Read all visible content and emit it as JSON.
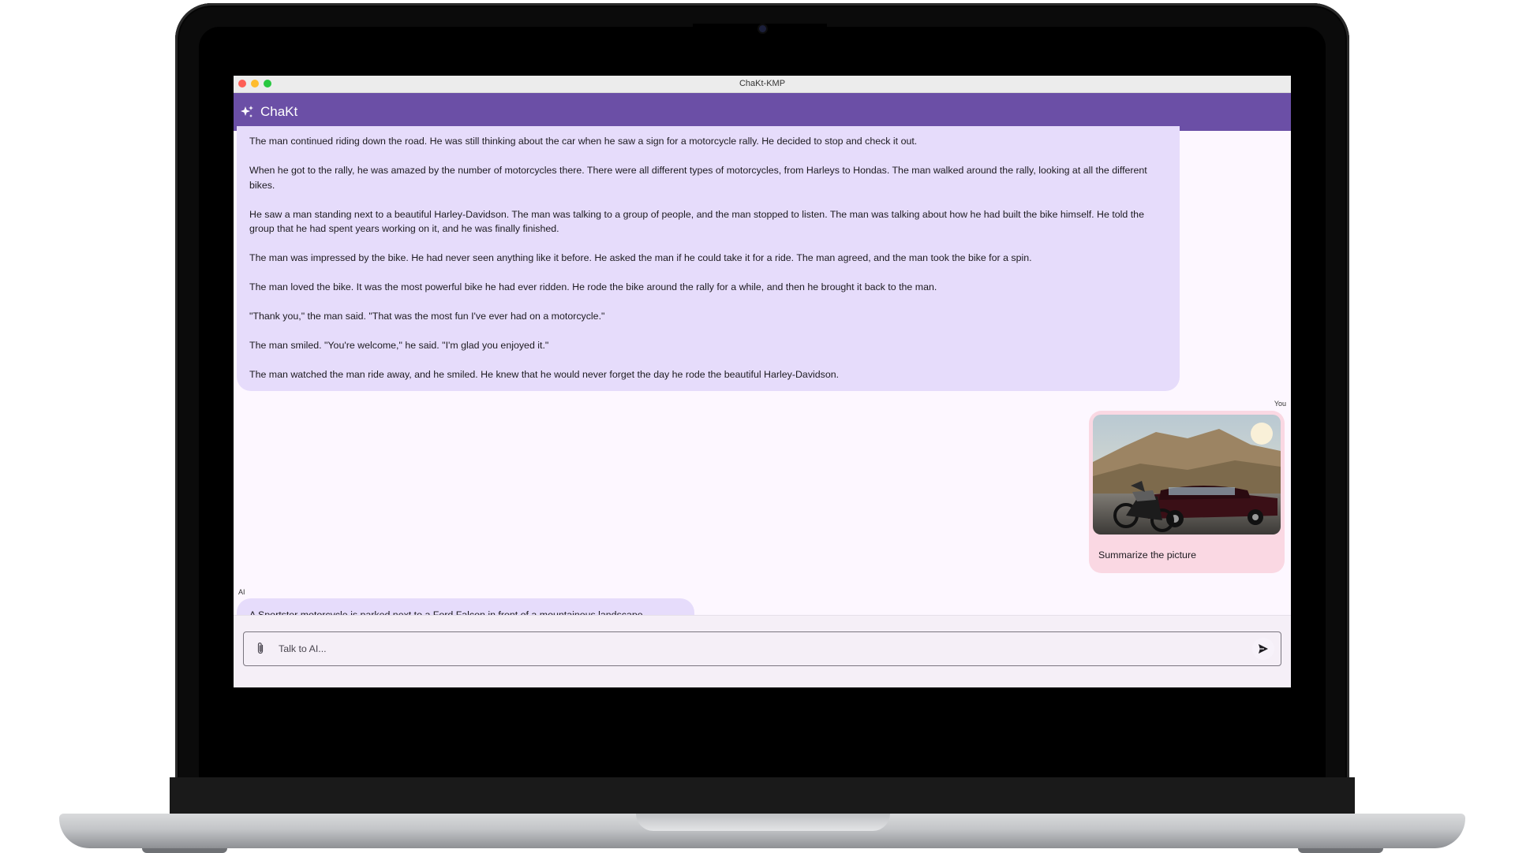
{
  "window": {
    "title": "ChaKt-KMP"
  },
  "appbar": {
    "title": "ChaKt",
    "icon": "sparkle-icon"
  },
  "messages": {
    "ai_long": [
      "The man continued riding down the road. He was still thinking about the car when he saw a sign for a motorcycle rally. He decided to stop and check it out.",
      "When he got to the rally, he was amazed by the number of motorcycles there. There were all different types of motorcycles, from Harleys to Hondas. The man walked around the rally, looking at all the different bikes.",
      "He saw a man standing next to a beautiful Harley-Davidson. The man was talking to a group of people, and the man stopped to listen. The man was talking about how he had built the bike himself. He told the group that he had spent years working on it, and he was finally finished.",
      "The man was impressed by the bike. He had never seen anything like it before. He asked the man if he could take it for a ride. The man agreed, and the man took the bike for a spin.",
      "The man loved the bike. It was the most powerful bike he had ever ridden. He rode the bike around the rally for a while, and then he brought it back to the man.",
      "\"Thank you,\" the man said. \"That was the most fun I've ever had on a motorcycle.\"",
      "The man smiled. \"You're welcome,\" he said. \"I'm glad you enjoyed it.\"",
      "The man watched the man ride away, and he smiled. He knew that he would never forget the day he rode the beautiful Harley-Davidson."
    ],
    "you_label": "You",
    "user_text": "Summarize the picture",
    "ai_label": "AI",
    "ai_short": "A Sportster motorcycle is parked next to a Ford Falcon in front of a mountainous landscape."
  },
  "input": {
    "placeholder": "Talk to AI...",
    "value": ""
  },
  "colors": {
    "appbar": "#6b4fa6",
    "ai_bubble": "#e6dcfb",
    "user_bubble": "#fad8e3",
    "background": "#fdf7ff"
  }
}
